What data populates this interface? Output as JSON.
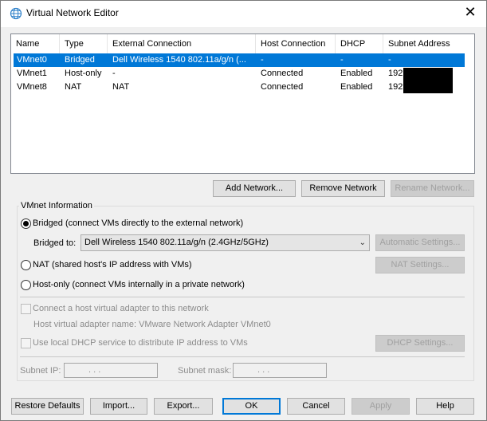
{
  "window": {
    "title": "Virtual Network Editor",
    "icon": "globe-network-icon",
    "close_glyph": "✕"
  },
  "list": {
    "columns": [
      "Name",
      "Type",
      "External Connection",
      "Host Connection",
      "DHCP",
      "Subnet Address"
    ],
    "rows": [
      {
        "name": "VMnet0",
        "type": "Bridged",
        "external": "Dell Wireless 1540 802.11a/g/n (...",
        "host": "-",
        "dhcp": "-",
        "subnet": "-",
        "selected": true
      },
      {
        "name": "VMnet1",
        "type": "Host-only",
        "external": "-",
        "host": "Connected",
        "dhcp": "Enabled",
        "subnet": "192",
        "redacted": true
      },
      {
        "name": "VMnet8",
        "type": "NAT",
        "external": "NAT",
        "host": "Connected",
        "dhcp": "Enabled",
        "subnet": "192",
        "redacted": true
      }
    ]
  },
  "network_buttons": {
    "add": "Add Network...",
    "remove": "Remove Network",
    "rename": "Rename Network..."
  },
  "vmnet_info": {
    "legend": "VMnet Information",
    "bridged_label": "Bridged (connect VMs directly to the external network)",
    "bridged_to_label": "Bridged to:",
    "bridged_to_value": "Dell Wireless 1540 802.11a/g/n (2.4GHz/5GHz)",
    "automatic_settings": "Automatic Settings...",
    "nat_label": "NAT (shared host's IP address with VMs)",
    "nat_settings": "NAT Settings...",
    "hostonly_label": "Host-only (connect VMs internally in a private network)",
    "connect_adapter_label": "Connect a host virtual adapter to this network",
    "adapter_name_label": "Host virtual adapter name: VMware Network Adapter VMnet0",
    "dhcp_label": "Use local DHCP service to distribute IP address to VMs",
    "dhcp_settings": "DHCP Settings...",
    "subnet_ip_label": "Subnet IP:",
    "subnet_ip_value": "  .     .     .",
    "subnet_mask_label": "Subnet mask:",
    "subnet_mask_value": "  .     .     ."
  },
  "footer": {
    "restore": "Restore Defaults",
    "import": "Import...",
    "export": "Export...",
    "ok": "OK",
    "cancel": "Cancel",
    "apply": "Apply",
    "help": "Help"
  },
  "colors": {
    "selection": "#0078d7",
    "dialog_bg": "#f0f0f0"
  }
}
